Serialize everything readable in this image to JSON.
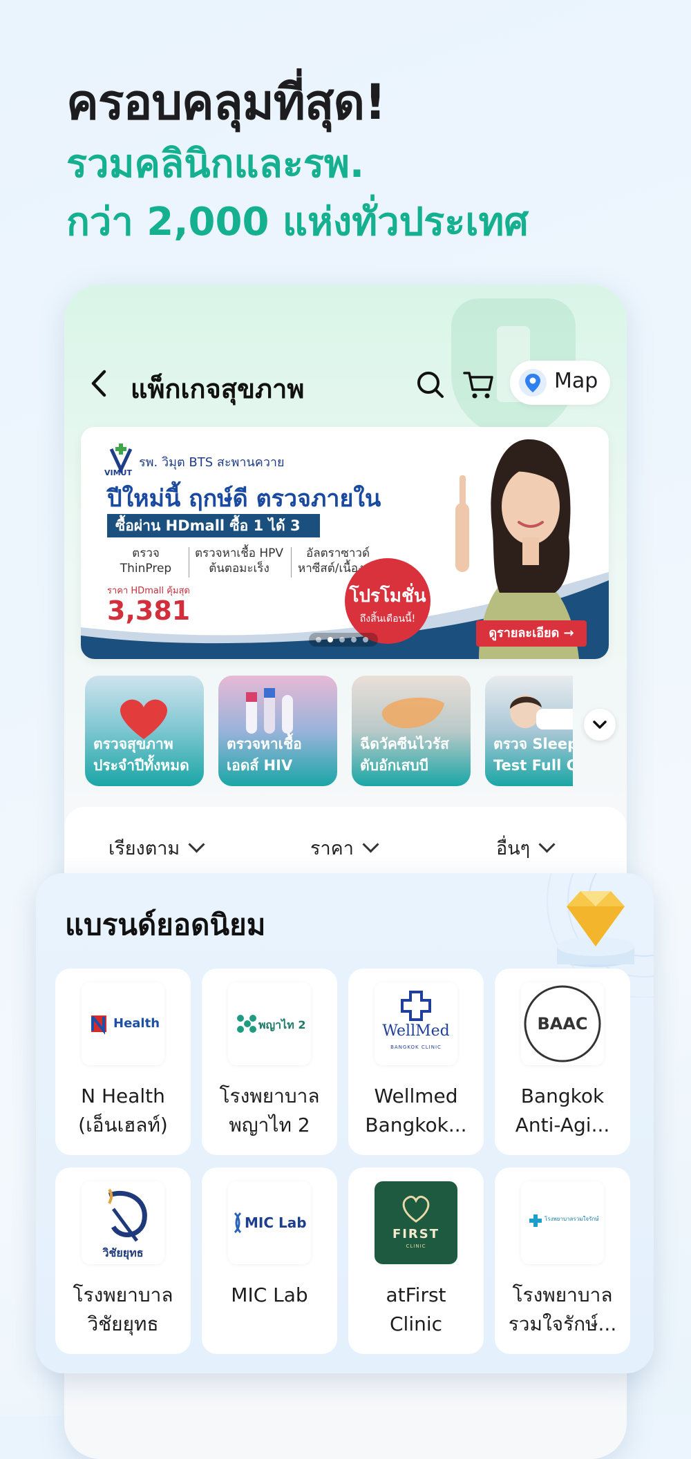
{
  "hero": {
    "title": "ครอบคลุมที่สุด!",
    "subtitle_line1": "รวมคลินิกและรพ.",
    "subtitle_line2": "กว่า 2,000 แห่งทั่วประเทศ"
  },
  "appbar": {
    "title": "แพ็กเกจสุขภาพ",
    "map_label": "Map"
  },
  "banner": {
    "logo_text": "VIMUT",
    "branch": "รพ. วิมุต BTS สะพานควาย",
    "headline": "ปีใหม่นี้ ฤกษ์ดี ตรวจภายใน",
    "strip": "ซื้อผ่าน HDmall ซื้อ 1 ได้ 3",
    "services": [
      {
        "line1": "ตรวจ",
        "line2": "ThinPrep"
      },
      {
        "line1": "ตรวจหาเชื้อ HPV",
        "line2": "ต้นตอมะเร็ง"
      },
      {
        "line1": "อัลตราซาวด์",
        "line2": "หาซีสต์/เนื้องอก"
      }
    ],
    "price_label": "ราคา HDmall คุ้มสุด",
    "price": "3,381",
    "promo_main": "โปรโมชั่น",
    "promo_sub": "ถึงสิ้นเดือนนี้!",
    "details_button": "ดูรายละเอียด →",
    "carousel_total": 5,
    "carousel_active": 2
  },
  "categories": [
    {
      "line1": "ตรวจสุขภาพ",
      "line2": "ประจำปีทั้งหมด"
    },
    {
      "line1": "ตรวจหาเชื้อ",
      "line2": "เอดส์ HIV"
    },
    {
      "line1": "ฉีดวัคซีนไวรัส",
      "line2": "ตับอักเสบบี"
    },
    {
      "line1": "ตรวจ Sleep",
      "line2": "Test Full C"
    }
  ],
  "filters": {
    "sort": "เรียงตาม",
    "price": "ราคา",
    "other": "อื่นๆ"
  },
  "brands": {
    "title": "แบรนด์ยอดนิยม",
    "items": [
      {
        "line1": "N Health",
        "line2": "(เอ็นเฮลท์)",
        "logo_text": "Health"
      },
      {
        "line1": "โรงพยาบาล",
        "line2": "พญาไท 2",
        "logo_text": "พญาไท 2"
      },
      {
        "line1": "Wellmed",
        "line2": "Bangkok...",
        "logo_text": "WellMed",
        "logo_sub": "BANGKOK CLINIC"
      },
      {
        "line1": "Bangkok",
        "line2": "Anti-Agi...",
        "logo_text": "BAAC"
      },
      {
        "line1": "โรงพยาบาล",
        "line2": "วิชัยยุทธ",
        "logo_text": "วิชัยยุทธ"
      },
      {
        "line1": "MIC Lab",
        "line2": "",
        "logo_text": "MIC Lab"
      },
      {
        "line1": "atFirst",
        "line2": "Clinic",
        "logo_text": "FIRST",
        "logo_sub": "CLINIC"
      },
      {
        "line1": "โรงพยาบาล",
        "line2": "รวมใจรักษ์...",
        "logo_text": "โรงพยาบาลรวมใจรักษ์"
      }
    ]
  },
  "colors": {
    "accent_green": "#14b08f",
    "promo_red": "#d9323d",
    "banner_blue": "#1a4aa0"
  }
}
